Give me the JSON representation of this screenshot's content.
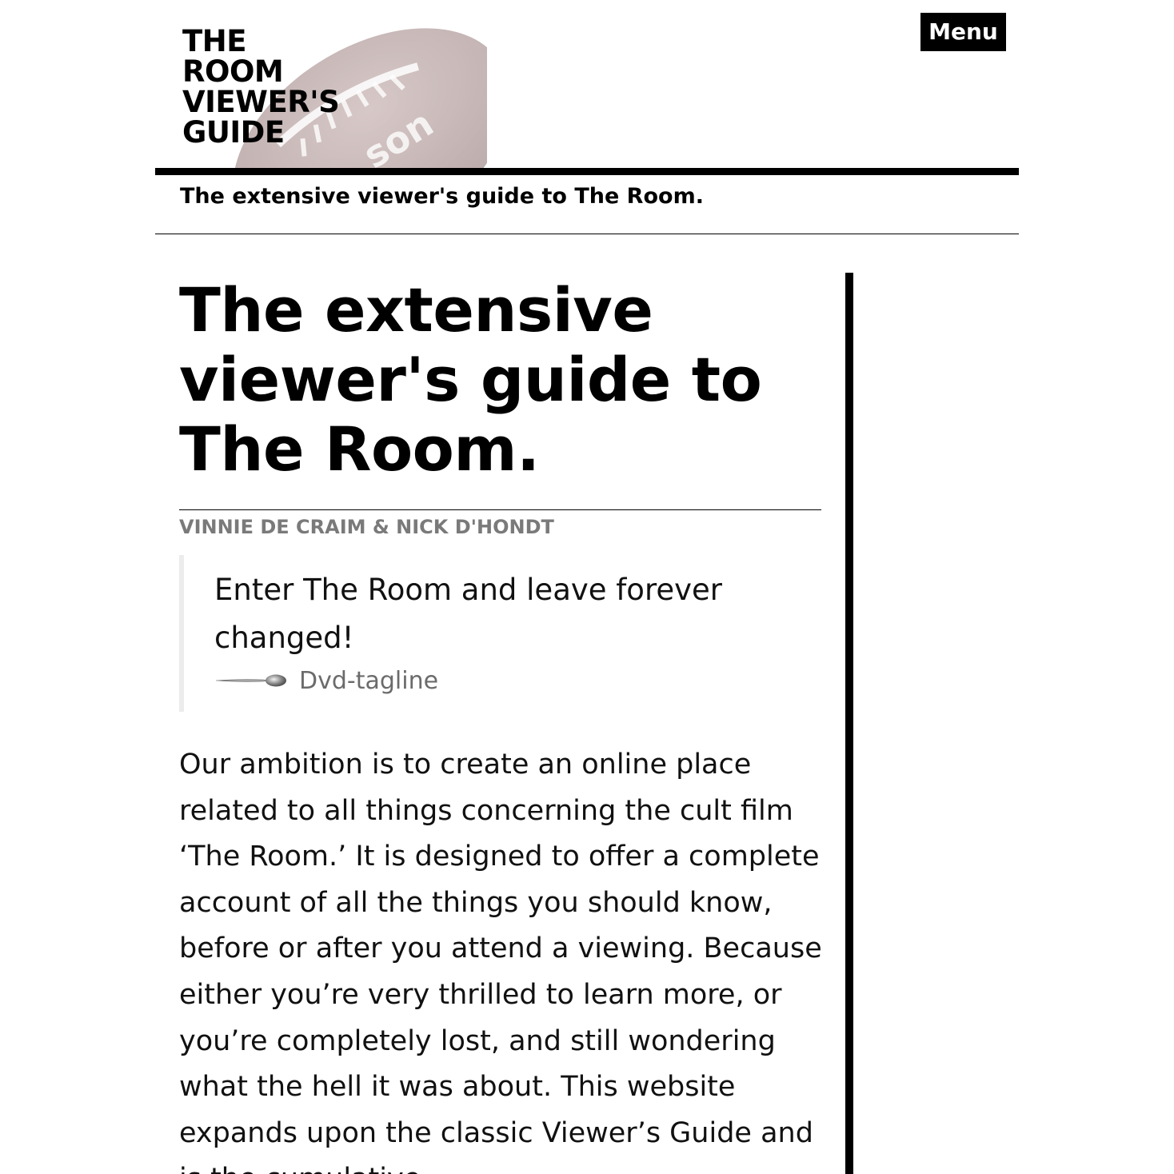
{
  "header": {
    "title_lines": [
      "THE",
      "ROOM",
      "VIEWER'S",
      "GUIDE"
    ],
    "menu_label": "Menu",
    "tagline": "The extensive viewer's guide to The Room."
  },
  "article": {
    "title": "The extensive viewer's guide to The Room.",
    "byline": "VINNIE DE CRAIM & NICK D'HONDT",
    "quote": {
      "text": "Enter The Room and leave forever changed!",
      "cite": "Dvd-tagline",
      "cite_icon": "spoon-icon"
    },
    "body": "Our ambition is to create an online place related to all things concerning the cult film ‘The Room.’ It is designed to offer a complete account of all the things you should know, before or after you attend a viewing. Because either you’re very thrilled to learn more, or you’re completely lost, and still wondering what the hell it was about. This website expands upon the classic Viewer’s Guide and is the cumulative"
  },
  "colors": {
    "accent": "#000000",
    "byline": "#7a7a7a",
    "cite": "#6b6b6b",
    "quote_border": "#ececec",
    "football": "#8a6a6a"
  }
}
